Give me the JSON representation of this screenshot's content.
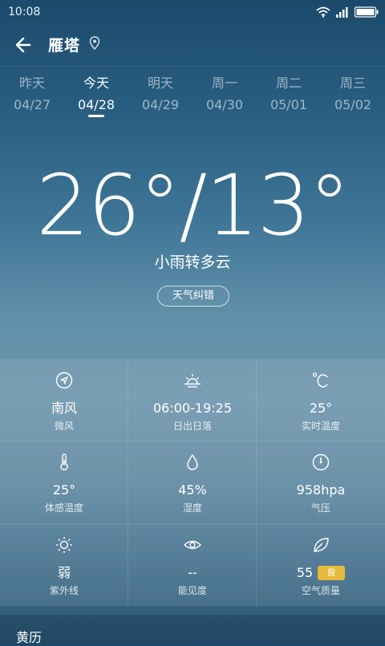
{
  "status": {
    "time": "10:08"
  },
  "header": {
    "city": "雁塔"
  },
  "days": [
    {
      "name": "昨天",
      "date": "04/27"
    },
    {
      "name": "今天",
      "date": "04/28"
    },
    {
      "name": "明天",
      "date": "04/29"
    },
    {
      "name": "周一",
      "date": "04/30"
    },
    {
      "name": "周二",
      "date": "05/01"
    },
    {
      "name": "周三",
      "date": "05/02"
    }
  ],
  "current": {
    "temp_range": "26°/13°",
    "condition": "小雨转多云",
    "feedback_label": "天气纠错"
  },
  "details": {
    "wind": {
      "icon": "compass-icon",
      "value": "南风",
      "label": "微风"
    },
    "sun": {
      "icon": "sunrise-icon",
      "value": "06:00-19:25",
      "label": "日出日落"
    },
    "realtemp": {
      "icon": "celsius-icon",
      "value": "25°",
      "label": "实时温度"
    },
    "feels": {
      "icon": "thermometer-icon",
      "value": "25°",
      "label": "体感温度"
    },
    "humidity": {
      "icon": "droplet-icon",
      "value": "45%",
      "label": "湿度"
    },
    "pressure": {
      "icon": "gauge-icon",
      "value": "958hpa",
      "label": "气压"
    },
    "uv": {
      "icon": "sun-icon",
      "value": "弱",
      "label": "紫外线"
    },
    "visibility": {
      "icon": "eye-icon",
      "value": "--",
      "label": "能见度"
    },
    "aqi": {
      "icon": "leaf-icon",
      "value": "55",
      "badge": "良",
      "label": "空气质量",
      "badge_color": "#e7b93c"
    }
  },
  "bottom": {
    "title": "黄历"
  }
}
